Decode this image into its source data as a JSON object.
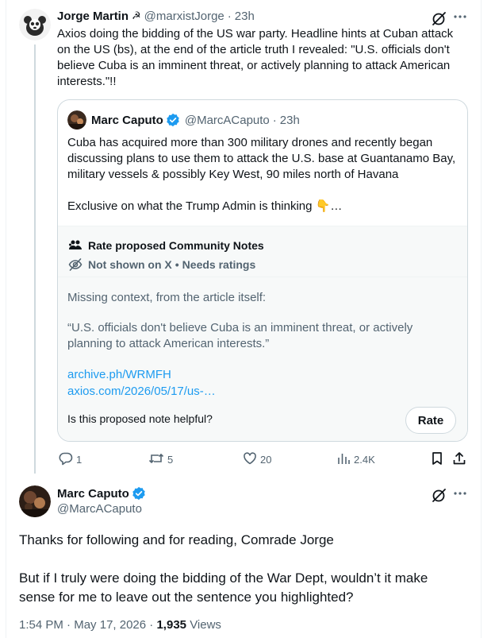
{
  "tweet1": {
    "name": "Jorge Martin",
    "flag_glyph": "☭",
    "handle": "@marxistJorge",
    "dot": "·",
    "time": "23h",
    "text": "Axios doing the bidding of the US war party. Headline hints at Cuban attack on the US (bs), at the end of the article truth I revealed: \"U.S. officials don't believe Cuba is an imminent threat, or actively planning to attack American interests.\"!!",
    "quote": {
      "name": "Marc Caputo",
      "handle": "@MarcACaputo",
      "dot": "·",
      "time": "23h",
      "text_p1": "Cuba has acquired more than 300 military drones and recently began discussing plans to use them to attack the U.S. base at Guantanamo Bay, military vessels & possibly Key West, 90 miles north of Havana",
      "text_p2": "Exclusive on what the Trump Admin is thinking 👇…"
    },
    "community_note": {
      "title": "Rate proposed Community Notes",
      "status_main": "Not shown on X",
      "status_sep": "•",
      "status_rest": "Needs ratings",
      "body_1": "Missing context, from the article itself:",
      "body_2": "“U.S. officials don't believe Cuba is an imminent threat, or actively planning to attack American interests.”",
      "link_1": "archive.ph/WRMFH",
      "link_2": "axios.com/2026/05/17/us-…",
      "question": "Is this proposed note helpful?",
      "rate_label": "Rate"
    },
    "actions": {
      "replies": "1",
      "reposts": "5",
      "likes": "20",
      "views": "2.4K"
    }
  },
  "tweet2": {
    "name": "Marc Caputo",
    "handle": "@MarcACaputo",
    "text_p1": "Thanks for following and for reading, Comrade Jorge",
    "text_p2": "But if I truly were doing the bidding of the War Dept, wouldn’t it make sense for me to leave out the sentence you highlighted?",
    "time": "1:54 PM",
    "dot1": "·",
    "date": "May 17, 2026",
    "dot2": "·",
    "views_count": "1,935",
    "views_label": "Views"
  },
  "colors": {
    "accent_blue": "#1d9bf0",
    "text_primary": "#0f1419",
    "text_secondary": "#536471",
    "border": "#cfd9de",
    "note_bg": "#f7f9f9"
  },
  "icons": {
    "grok": "grok-icon",
    "more": "more-icon",
    "verified": "verified-badge-icon",
    "people": "people-icon",
    "eye_off": "eye-off-icon",
    "reply": "reply-icon",
    "repost": "repost-icon",
    "like": "heart-icon",
    "views": "views-icon",
    "bookmark": "bookmark-icon",
    "share": "share-icon"
  }
}
